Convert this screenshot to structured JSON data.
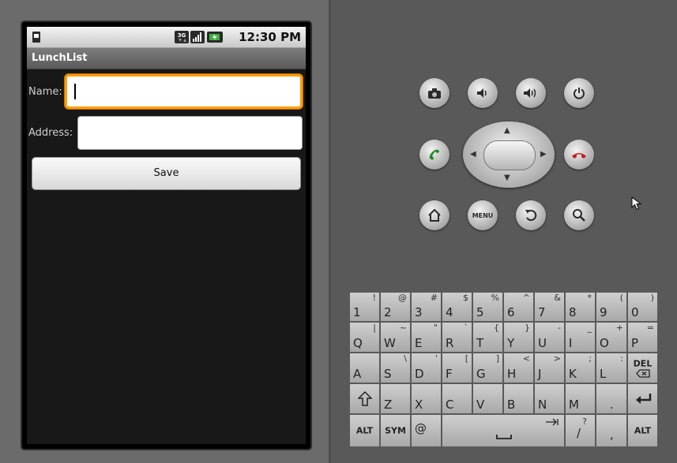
{
  "status_bar": {
    "time": "12:30 PM",
    "network": "3G"
  },
  "app": {
    "title": "LunchList"
  },
  "form": {
    "name_label": "Name:",
    "name_value": "",
    "address_label": "Address:",
    "address_value": "",
    "save_label": "Save"
  },
  "hardware": {
    "menu_label": "MENU"
  },
  "keyboard": {
    "rows": [
      [
        [
          "1",
          "!"
        ],
        [
          "2",
          "@"
        ],
        [
          "3",
          "#"
        ],
        [
          "4",
          "$"
        ],
        [
          "5",
          "%"
        ],
        [
          "6",
          "^"
        ],
        [
          "7",
          "&"
        ],
        [
          "8",
          "*"
        ],
        [
          "9",
          "("
        ],
        [
          "0",
          ")"
        ]
      ],
      [
        [
          "Q",
          "|"
        ],
        [
          "W",
          "~"
        ],
        [
          "E",
          "\""
        ],
        [
          "R",
          "`"
        ],
        [
          "T",
          "{"
        ],
        [
          "Y",
          "}"
        ],
        [
          "U",
          "-"
        ],
        [
          "I",
          "_"
        ],
        [
          "O",
          "+"
        ],
        [
          "P",
          "="
        ]
      ],
      [
        [
          "A",
          ""
        ],
        [
          "S",
          "\\"
        ],
        [
          "D",
          "'"
        ],
        [
          "F",
          "["
        ],
        [
          "G",
          "]"
        ],
        [
          "H",
          "<"
        ],
        [
          "J",
          ">"
        ],
        [
          "K",
          ";"
        ],
        [
          "L",
          ":"
        ]
      ],
      [
        [
          "Z",
          ""
        ],
        [
          "X",
          ""
        ],
        [
          "C",
          ""
        ],
        [
          "V",
          ""
        ],
        [
          "B",
          ""
        ],
        [
          "N",
          ""
        ],
        [
          "M",
          ""
        ],
        [
          ".",
          ""
        ]
      ]
    ],
    "del_label": "DEL",
    "alt_label": "ALT",
    "sym_label": "SYM",
    "at_label": "@",
    "slash_label": "/",
    "slash_alt": "?",
    "comma_label": ","
  }
}
